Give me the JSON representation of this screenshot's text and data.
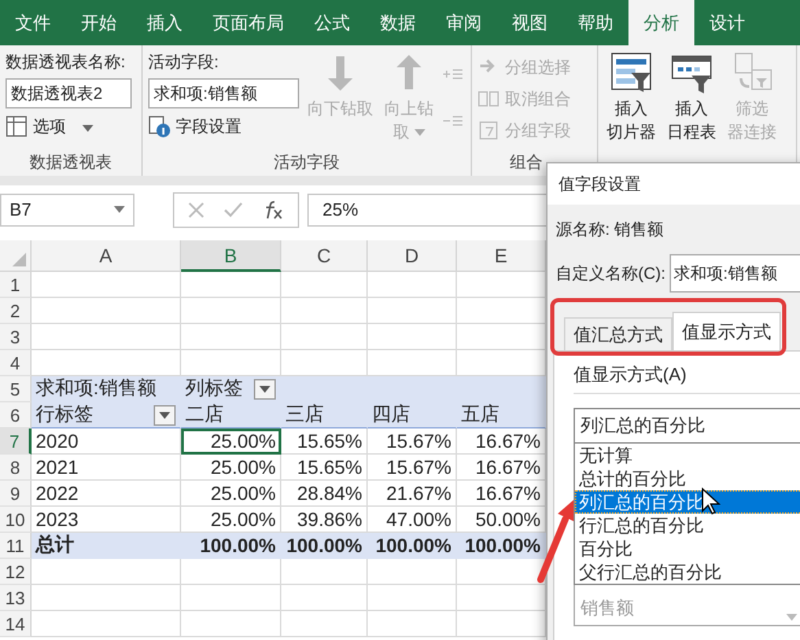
{
  "ribbon_tabs": [
    {
      "label": "文件",
      "selected": false
    },
    {
      "label": "开始",
      "selected": false
    },
    {
      "label": "插入",
      "selected": false
    },
    {
      "label": "页面布局",
      "selected": false
    },
    {
      "label": "公式",
      "selected": false
    },
    {
      "label": "数据",
      "selected": false
    },
    {
      "label": "审阅",
      "selected": false
    },
    {
      "label": "视图",
      "selected": false
    },
    {
      "label": "帮助",
      "selected": false
    },
    {
      "label": "分析",
      "selected": true
    },
    {
      "label": "设计",
      "selected": false
    }
  ],
  "ribbon_groups": [
    {
      "kind": "pivot_table",
      "label": "数据透视表",
      "name_label": "数据透视表名称:",
      "name_value": "数据透视表2",
      "options": "选项"
    },
    {
      "kind": "active_field",
      "label": "活动字段",
      "field_label": "活动字段:",
      "field_value": "求和项:销售额",
      "settings": "字段设置",
      "buttons": [
        {
          "lines": [
            "向下钻取"
          ],
          "disabled": true,
          "caret": false
        },
        {
          "lines": [
            "向上钻",
            "取"
          ],
          "disabled": true,
          "caret": true
        }
      ]
    },
    {
      "kind": "group",
      "label": "组合",
      "items": [
        {
          "label": "分组选择",
          "disabled": true
        },
        {
          "label": "取消组合",
          "disabled": true
        },
        {
          "label": "分组字段",
          "disabled": true
        }
      ]
    },
    {
      "kind": "filter",
      "buttons": [
        {
          "lines": [
            "插入",
            "切片器"
          ],
          "disabled": false
        },
        {
          "lines": [
            "插入",
            "日程表"
          ],
          "disabled": false
        },
        {
          "lines": [
            "筛选",
            "器连接"
          ],
          "disabled": true
        }
      ]
    }
  ],
  "name_box": "B7",
  "formula": "25%",
  "columns": [
    {
      "label": "A",
      "selected": false
    },
    {
      "label": "B",
      "selected": true
    },
    {
      "label": "C",
      "selected": false
    },
    {
      "label": "D",
      "selected": false
    },
    {
      "label": "E",
      "selected": false
    }
  ],
  "rows": [
    {
      "number": "1",
      "selected": false,
      "kind": "blank"
    },
    {
      "number": "2",
      "selected": false,
      "kind": "blank"
    },
    {
      "number": "3",
      "selected": false,
      "kind": "blank"
    },
    {
      "number": "4",
      "selected": false,
      "kind": "blank"
    },
    {
      "number": "5",
      "selected": false,
      "kind": "heading",
      "cells": [
        {
          "text": "求和项:销售额",
          "filter": false
        },
        {
          "text": "列标签",
          "filter": true
        }
      ]
    },
    {
      "number": "6",
      "selected": false,
      "kind": "heading",
      "cells": [
        {
          "text": "行标签",
          "filter": true
        },
        {
          "text": "二店",
          "filter": false
        },
        {
          "text": "三店",
          "filter": false
        },
        {
          "text": "四店",
          "filter": false
        },
        {
          "text": "五店",
          "filter": false
        }
      ]
    },
    {
      "number": "7",
      "selected": true,
      "kind": "data",
      "cells": [
        "2020",
        "25.00%",
        "15.65%",
        "15.67%",
        "16.67%"
      ]
    },
    {
      "number": "8",
      "selected": false,
      "kind": "data",
      "cells": [
        "2021",
        "25.00%",
        "15.65%",
        "15.67%",
        "16.67%"
      ]
    },
    {
      "number": "9",
      "selected": false,
      "kind": "data",
      "cells": [
        "2022",
        "25.00%",
        "28.84%",
        "21.67%",
        "16.67%"
      ]
    },
    {
      "number": "10",
      "selected": false,
      "kind": "data",
      "cells": [
        "2023",
        "25.00%",
        "39.86%",
        "47.00%",
        "50.00%"
      ]
    },
    {
      "number": "11",
      "selected": false,
      "kind": "total",
      "cells": [
        "总计",
        "100.00%",
        "100.00%",
        "100.00%",
        "100.00%"
      ]
    },
    {
      "number": "12",
      "selected": false,
      "kind": "blank"
    },
    {
      "number": "13",
      "selected": false,
      "kind": "blank"
    },
    {
      "number": "14",
      "selected": false,
      "kind": "blank"
    }
  ],
  "dialog": {
    "title": "值字段设置",
    "source_label": "源名称:",
    "source_value": "销售额",
    "custom_name_label": "自定义名称(C):",
    "custom_name_value": "求和项:销售额",
    "tabs": [
      {
        "label": "值汇总方式",
        "selected": false
      },
      {
        "label": "值显示方式",
        "selected": true
      }
    ],
    "show_as_label": "值显示方式(A)",
    "show_as_value": "列汇总的百分比",
    "options": [
      {
        "label": "无计算",
        "selected": false
      },
      {
        "label": "总计的百分比",
        "selected": false
      },
      {
        "label": "列汇总的百分比",
        "selected": true
      },
      {
        "label": "行汇总的百分比",
        "selected": false
      },
      {
        "label": "百分比",
        "selected": false
      },
      {
        "label": "父行汇总的百分比",
        "selected": false
      }
    ],
    "base_item": {
      "value": "销售额",
      "disabled": true
    }
  }
}
